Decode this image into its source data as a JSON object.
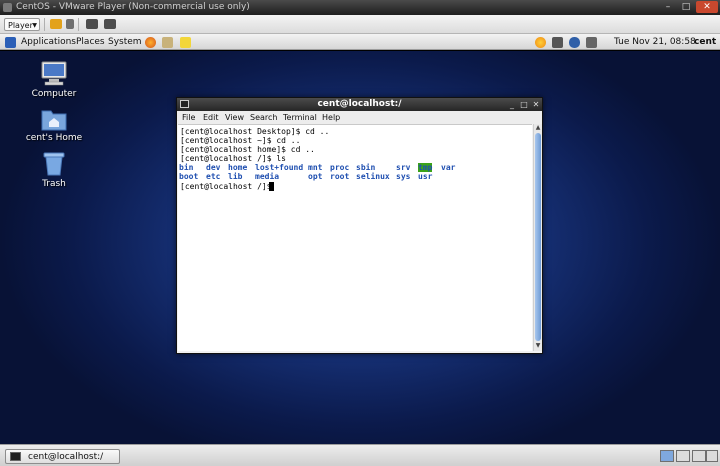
{
  "vmware": {
    "title": "CentOS - VMware Player (Non-commercial use only)",
    "player_label": "Player"
  },
  "panel": {
    "menus": [
      "Applications",
      "Places",
      "System"
    ],
    "clock": "Tue Nov 21, 08:58",
    "user": "cent"
  },
  "desktop": {
    "icons": [
      "Computer",
      "cent's Home",
      "Trash"
    ]
  },
  "terminal": {
    "title": "cent@localhost:/",
    "menu": [
      "File",
      "Edit",
      "View",
      "Search",
      "Terminal",
      "Help"
    ],
    "lines": [
      "[cent@localhost Desktop]$ cd ..",
      "[cent@localhost ~]$ cd ..",
      "[cent@localhost home]$ cd ..",
      "[cent@localhost /]$ ls"
    ],
    "ls_row1": [
      "bin",
      "dev",
      "home",
      "lost+found",
      "mnt",
      "proc",
      "sbin",
      "srv",
      "tmp",
      "var"
    ],
    "ls_row2": [
      "boot",
      "etc",
      "lib",
      "media",
      "opt",
      "root",
      "selinux",
      "sys",
      "usr"
    ],
    "prompt": "[cent@localhost /]$ "
  },
  "taskbar": {
    "task_label": "cent@localhost:/"
  },
  "colors": {
    "ls_dir": "#1f4fb0",
    "tmp_highlight": "#3ba318",
    "close_button": "#c9482e"
  }
}
